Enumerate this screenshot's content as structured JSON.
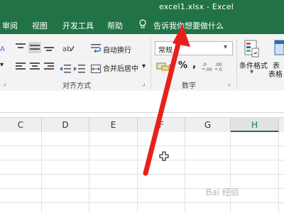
{
  "window": {
    "title": "excel1.xlsx  -  Excel"
  },
  "menu": {
    "items": [
      "审阅",
      "视图",
      "开发工具",
      "帮助"
    ],
    "tell_me": "告诉我你想要做什么"
  },
  "ribbon": {
    "wrap_text": "自动换行",
    "merge_center": "合并后居中",
    "merge_dropdown": "▾",
    "number_format": "常规",
    "percent": "%",
    "comma": ",",
    "cond_format": "条件格式",
    "table_format_1": "表",
    "table_format_2": "表格",
    "group_alignment": "对齐方式",
    "group_number": "数字"
  },
  "columns": [
    "C",
    "D",
    "E",
    "F",
    "G",
    "H"
  ],
  "selected_column": "H",
  "watermark": "Bai 经验",
  "colors": {
    "excel_green": "#217346",
    "arrow_red": "#e8201d"
  }
}
